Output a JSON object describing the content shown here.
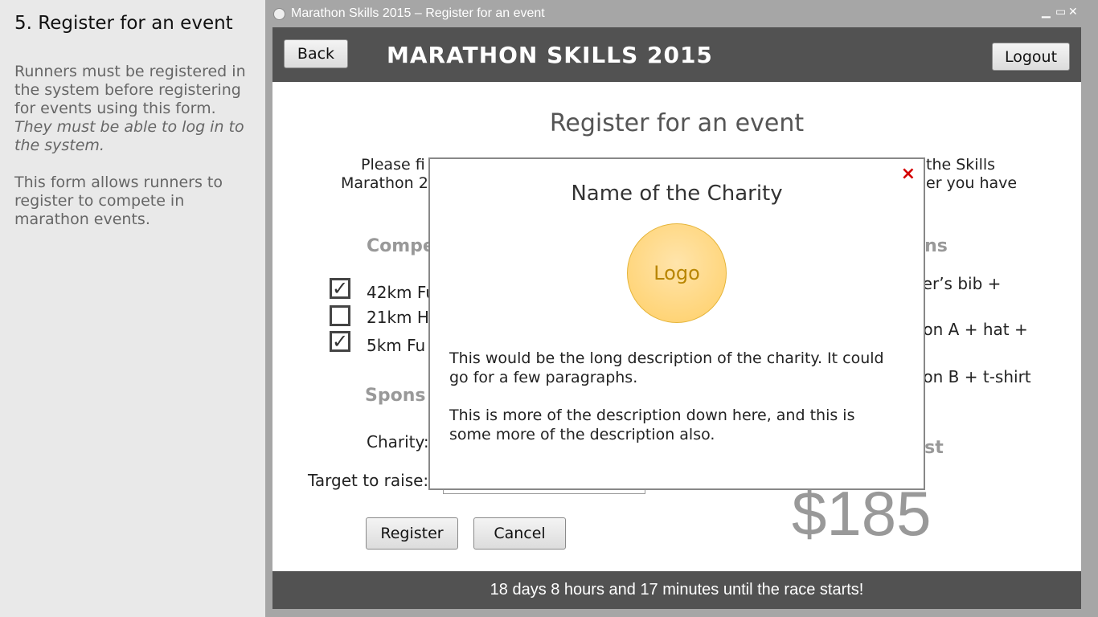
{
  "note": {
    "heading": "5. Register for an event",
    "para1": "Runners must be registered in the system before registering for events using this form.",
    "para1_em": "They must be able to log in to the system.",
    "para2": "This form allows runners to register to compete in marathon events."
  },
  "window": {
    "title": "Marathon Skills 2015 – Register for an event",
    "minimize": "▁",
    "maximize": "▭",
    "close": "✕"
  },
  "header": {
    "back": "Back",
    "title": "MARATHON SKILLS 2015",
    "logout": "Logout"
  },
  "page": {
    "title": "Register for an event",
    "intro_left_1": "Please fi",
    "intro_left_2": "Marathon 2",
    "intro_right_1": "the Skills",
    "intro_right_2": "er you have"
  },
  "competition": {
    "heading": "Compe",
    "events": [
      {
        "label": "42km Fu",
        "checked": true
      },
      {
        "label": "21km H",
        "checked": false
      },
      {
        "label": "5km Fu",
        "checked": true
      }
    ]
  },
  "sponsorship": {
    "heading": "Spons",
    "charity_label": "Charity:",
    "target_label": "Target to raise:"
  },
  "options": {
    "heading": "ons",
    "items": [
      "ner’s bib +",
      "tion A + hat +",
      "tion B + t-shirt"
    ]
  },
  "cost": {
    "heading": "ost",
    "value": "$185"
  },
  "actions": {
    "register": "Register",
    "cancel": "Cancel"
  },
  "footer": {
    "countdown": "18 days 8 hours and 17 minutes until the race starts!"
  },
  "modal": {
    "close": "×",
    "title": "Name of the Charity",
    "logo": "Logo",
    "desc1": "This would be the long description of the charity. It could go for a few paragraphs.",
    "desc2": "This is more of the description down here, and this is some more of the description also."
  },
  "colors": {
    "header_bg": "#525252",
    "close_x": "#d40000",
    "logo_fill": "#ffcf66"
  }
}
